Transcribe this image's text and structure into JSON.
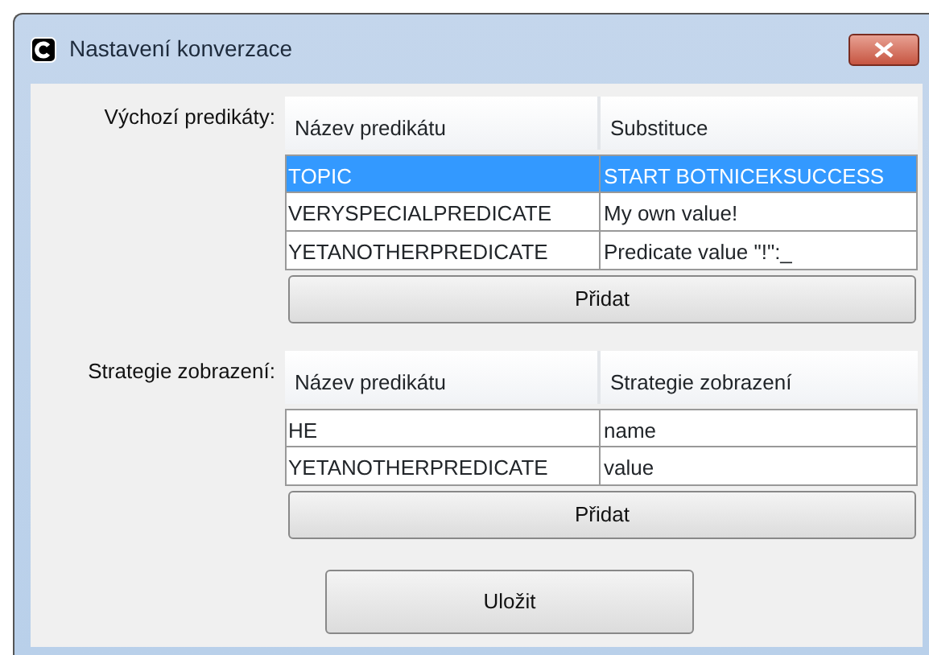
{
  "window": {
    "title": "Nastavení konverzace"
  },
  "sections": [
    {
      "label": "Výchozí predikáty:",
      "columns": [
        "Název predikátu",
        "Substituce"
      ],
      "rows": [
        {
          "cells": [
            "TOPIC",
            "START BOTNICEKSUCCESS"
          ],
          "selected": true
        },
        {
          "cells": [
            "VERYSPECIALPREDICATE",
            "My own value!"
          ],
          "selected": false
        },
        {
          "cells": [
            "YETANOTHERPREDICATE",
            "Predicate value \"!\":_"
          ],
          "selected": false
        }
      ],
      "button": "Přidat"
    },
    {
      "label": "Strategie zobrazení:",
      "columns": [
        "Název predikátu",
        "Strategie zobrazení"
      ],
      "rows": [
        {
          "cells": [
            "HE",
            "name"
          ],
          "selected": false
        },
        {
          "cells": [
            "YETANOTHERPREDICATE",
            "value"
          ],
          "selected": false
        }
      ],
      "button": "Přidat"
    }
  ],
  "save_button": "Uložit"
}
